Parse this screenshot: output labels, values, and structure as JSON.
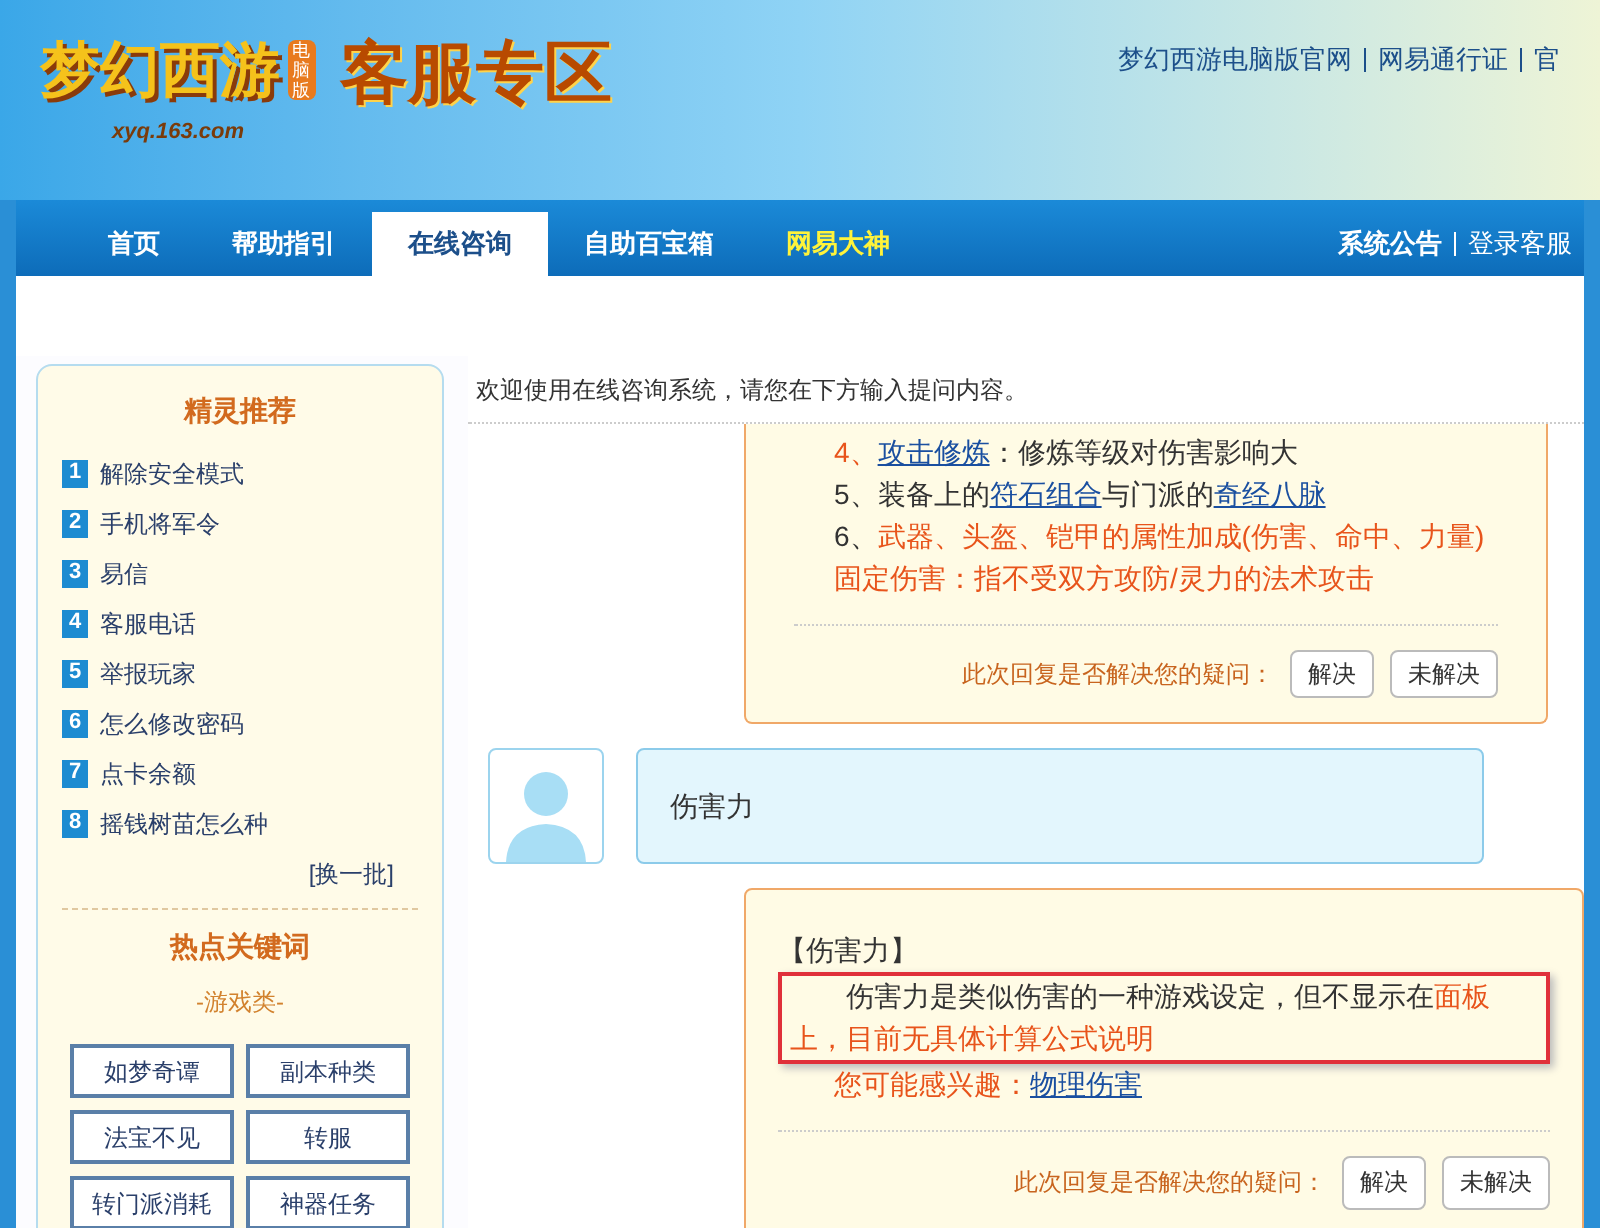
{
  "header": {
    "logo_title": "梦幻西游",
    "logo_badge": "电脑版",
    "logo_domain": "xyq.163.com",
    "section_title": "客服专区",
    "top_links": [
      "梦幻西游电脑版官网",
      "网易通行证",
      "官"
    ]
  },
  "nav": {
    "tabs": [
      {
        "label": "首页",
        "selected": false,
        "highlight": false
      },
      {
        "label": "帮助指引",
        "selected": false,
        "highlight": false
      },
      {
        "label": "在线咨询",
        "selected": true,
        "highlight": false
      },
      {
        "label": "自助百宝箱",
        "selected": false,
        "highlight": false
      },
      {
        "label": "网易大神",
        "selected": false,
        "highlight": true
      }
    ],
    "right_links": [
      "系统公告",
      "登录客服"
    ]
  },
  "sidebar": {
    "recommend_title": "精灵推荐",
    "recommend_items": [
      {
        "number": "1",
        "label": "解除安全模式"
      },
      {
        "number": "2",
        "label": "手机将军令"
      },
      {
        "number": "3",
        "label": "易信"
      },
      {
        "number": "4",
        "label": "客服电话"
      },
      {
        "number": "5",
        "label": "举报玩家"
      },
      {
        "number": "6",
        "label": "怎么修改密码"
      },
      {
        "number": "7",
        "label": "点卡余额"
      },
      {
        "number": "8",
        "label": "摇钱树苗怎么种"
      }
    ],
    "refresh_link": "[换一批]",
    "keywords_title": "热点关键词",
    "keywords_category": "-游戏类-",
    "keywords": [
      "如梦奇谭",
      "副本种类",
      "法宝不见",
      "转服",
      "转门派消耗",
      "神器任务"
    ]
  },
  "chat": {
    "welcome": "欢迎使用在线咨询系统，请您在下方输入提问内容。",
    "messages": [
      {
        "kind": "reply",
        "lines": [
          [
            {
              "text": "4、",
              "kind": "orange"
            },
            {
              "text": "攻击修炼",
              "kind": "link"
            },
            {
              "text": "：修炼等级对伤害影响大",
              "kind": "plain"
            }
          ],
          [
            {
              "text": "5、装备上的",
              "kind": "plain"
            },
            {
              "text": "符石组合",
              "kind": "link"
            },
            {
              "text": "与门派的",
              "kind": "plain"
            },
            {
              "text": "奇经八脉",
              "kind": "link"
            }
          ],
          [
            {
              "text": "6、",
              "kind": "plain"
            },
            {
              "text": "武器、头盔、铠甲的属性加成(伤害、命中、力量)",
              "kind": "orange"
            }
          ],
          [
            {
              "text": "固定伤害：指不受双方攻防/灵力的法术攻击",
              "kind": "orange"
            }
          ]
        ],
        "feedback_prompt": "此次回复是否解决您的疑问：",
        "buttons": [
          "解决",
          "未解决"
        ]
      },
      {
        "kind": "question",
        "text": "伤害力"
      },
      {
        "kind": "answer",
        "heading": "【伤害力】",
        "highlight_plain": "伤害力是类似伤害的一种游戏设定，但不显示在",
        "highlight_orange": "面板上，目前无具体计算公式说明",
        "interest_label": "您可能感兴趣：",
        "interest_link": "物理伤害",
        "feedback_prompt": "此次回复是否解决您的疑问：",
        "buttons": [
          "解决",
          "未解决"
        ]
      }
    ]
  }
}
